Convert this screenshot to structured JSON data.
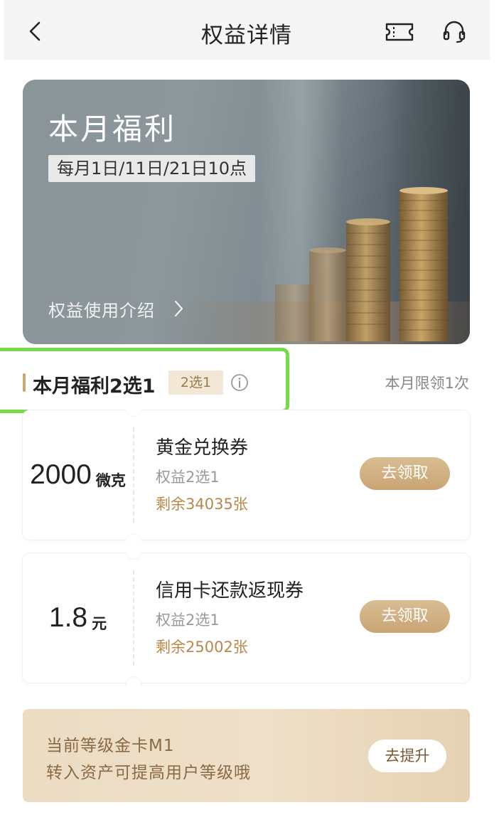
{
  "navbar": {
    "title": "权益详情",
    "back_icon": "chevron-left-icon",
    "ticket_icon": "ticket-icon",
    "service_icon": "headset-icon"
  },
  "banner": {
    "title": "本月福利",
    "time": "每月1日/11日/21日10点",
    "intro_label": "权益使用介绍"
  },
  "section": {
    "title": "本月福利2选1",
    "tag": "2选1",
    "info_icon": "info-icon",
    "limit": "本月限领1次",
    "highlight_color": "#7ad84b"
  },
  "coupons": [
    {
      "amount": "2000",
      "unit": "微克",
      "name": "黄金兑换券",
      "sub": "权益2选1",
      "remain": "剩余34035张",
      "button": "去领取"
    },
    {
      "amount": "1.8",
      "unit": "元",
      "name": "信用卡还款返现券",
      "sub": "权益2选1",
      "remain": "剩余25002张",
      "button": "去领取"
    }
  ],
  "level": {
    "line1": "当前等级金卡M1",
    "line2": "转入资产可提高用户等级哦",
    "button": "去提升"
  },
  "colors": {
    "accent_gold": "#c9a473",
    "remain_text": "#b8884a"
  }
}
